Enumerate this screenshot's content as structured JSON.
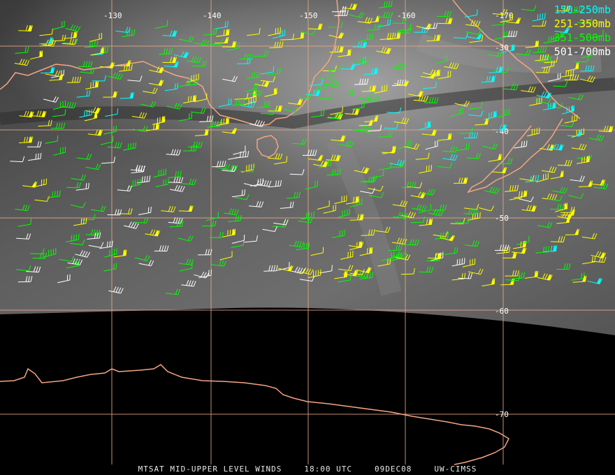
{
  "legend": [
    {
      "label": "150-250mb",
      "color": "#00ffff"
    },
    {
      "label": "251-350mb",
      "color": "#ffff00"
    },
    {
      "label": "351-500mb",
      "color": "#00ff00"
    },
    {
      "label": "501-700mb",
      "color": "#ffffff"
    }
  ],
  "longitude_labels": [
    "-130",
    "-140",
    "-150",
    "-160",
    "-170"
  ],
  "latitude_labels": [
    "-30",
    "-40",
    "-50",
    "-60",
    "-70"
  ],
  "footer": {
    "product": "MTSAT MID-UPPER LEVEL WINDS",
    "time": "18:00 UTC",
    "date": "09DEC08",
    "credit": "UW-CIMSS"
  },
  "colors": {
    "coastline": "#f4a582",
    "gridline": "#e8a888",
    "space": "#000000"
  }
}
